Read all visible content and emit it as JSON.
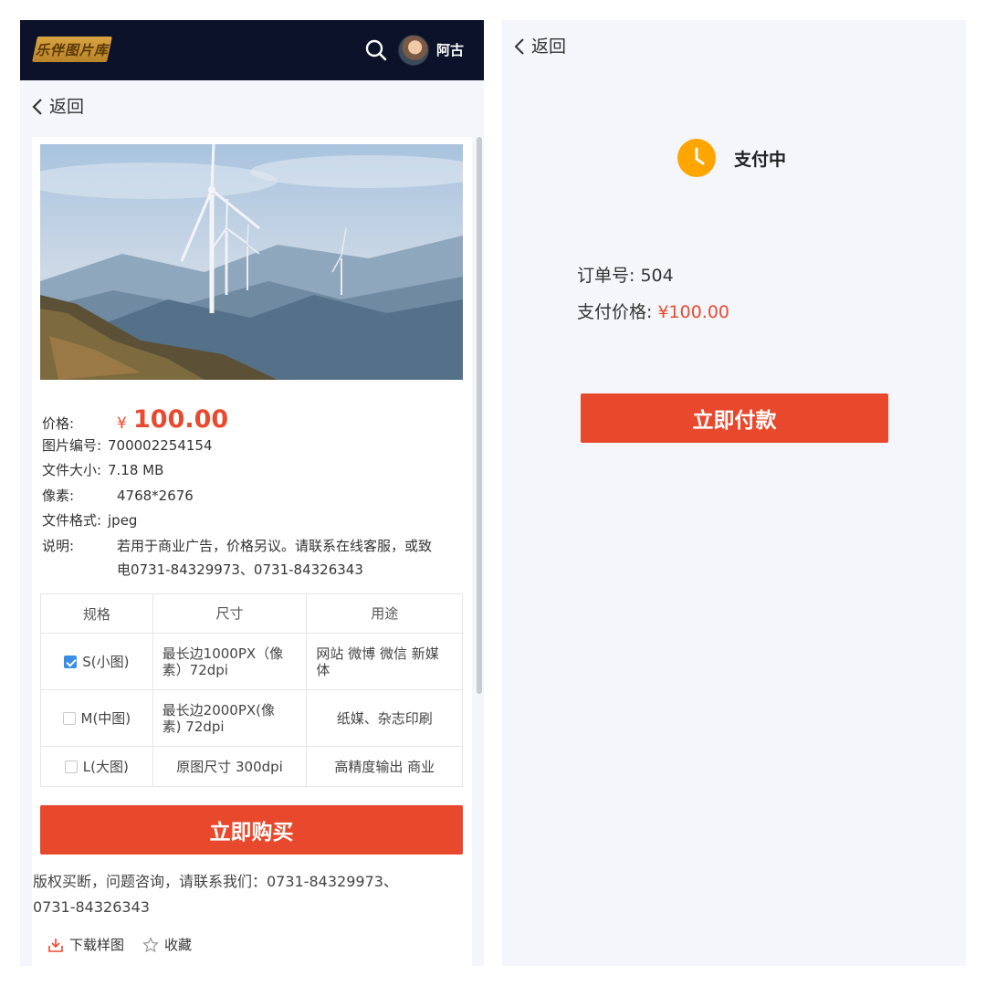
{
  "header": {
    "logo_text": "乐伴图片库",
    "search_icon": "search-icon",
    "user_name": "阿古"
  },
  "left": {
    "back_label": "返回",
    "price": {
      "label": "价格:",
      "currency": "¥",
      "amount": "100.00"
    },
    "details": [
      {
        "label": "图片编号:",
        "value": "700002254154"
      },
      {
        "label": "文件大小:",
        "value": "7.18 MB"
      },
      {
        "label": "像素:",
        "value": "4768*2676"
      },
      {
        "label": "文件格式:",
        "value": "jpeg"
      }
    ],
    "note": {
      "label": "说明:",
      "line1": "若用于商业广告，价格另议。请联系在线客服，或致",
      "line2": "电0731-84329973、0731-84326343"
    },
    "table": {
      "headers": [
        "规格",
        "尺寸",
        "用途"
      ],
      "rows": [
        {
          "spec": "S(小图)",
          "checked": true,
          "size_l1": "最长边1000PX（像",
          "size_l2": "素）72dpi",
          "use_l1": "网站 微博 微信 新媒",
          "use_l2": "体"
        },
        {
          "spec": "M(中图)",
          "checked": false,
          "size_l1": "最长边2000PX(像",
          "size_l2": "素) 72dpi",
          "use": "纸媒、杂志印刷"
        },
        {
          "spec": "L(大图)",
          "checked": false,
          "size": "原图尺寸 300dpi",
          "use": "高精度输出 商业"
        }
      ]
    },
    "buy_button": "立即购买",
    "contact_line1": "版权买断，问题咨询，请联系我们：0731-84329973、",
    "contact_line2": "0731-84326343",
    "actions": {
      "download": "下载样图",
      "favorite": "收藏"
    },
    "colors": {
      "accent": "#e8482c",
      "topbar": "#0b1229",
      "price": "#e84a30"
    }
  },
  "right": {
    "back_label": "返回",
    "status": "支付中",
    "order_label": "订单号:",
    "order_value": "504",
    "pay_price_label": "支付价格:",
    "pay_price_value": "¥100.00",
    "pay_button": "立即付款"
  }
}
